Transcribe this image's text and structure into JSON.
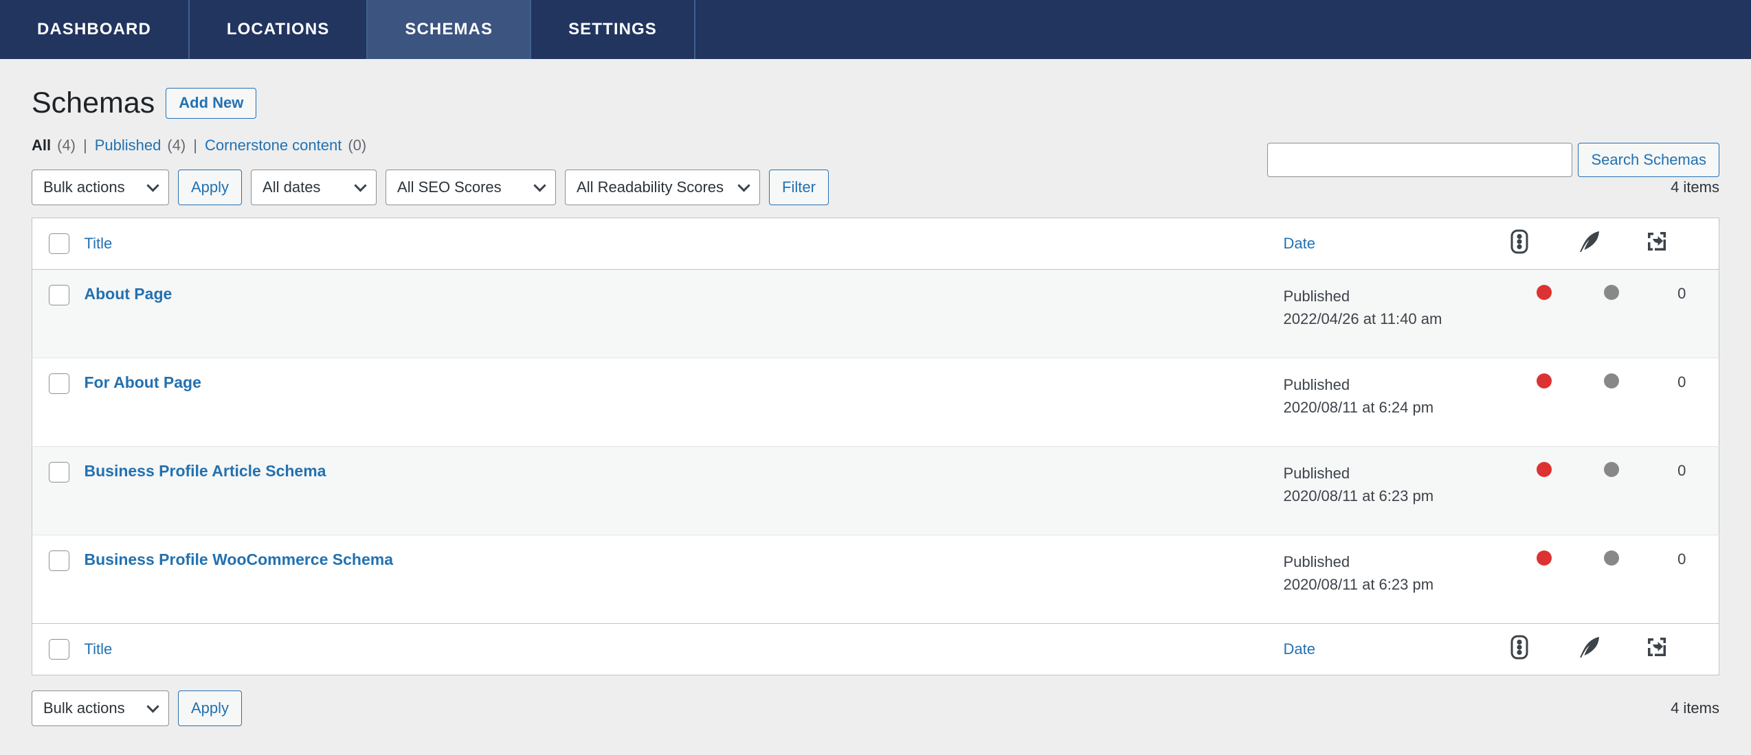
{
  "nav": {
    "tabs": [
      {
        "label": "DASHBOARD",
        "active": false
      },
      {
        "label": "LOCATIONS",
        "active": false
      },
      {
        "label": "SCHEMAS",
        "active": true
      },
      {
        "label": "SETTINGS",
        "active": false
      }
    ]
  },
  "header": {
    "title": "Schemas",
    "add_new_label": "Add New"
  },
  "status_links": {
    "all_label": "All",
    "all_count": "(4)",
    "published_label": "Published",
    "published_count": "(4)",
    "cornerstone_label": "Cornerstone content",
    "cornerstone_count": "(0)",
    "separator": "|"
  },
  "search": {
    "value": "",
    "placeholder": "",
    "button_label": "Search Schemas"
  },
  "toolbar_top": {
    "bulk_actions": "Bulk actions",
    "apply_label": "Apply",
    "all_dates": "All dates",
    "all_seo_scores": "All SEO Scores",
    "all_readability_scores": "All Readability Scores",
    "filter_label": "Filter",
    "items_count": "4 items"
  },
  "toolbar_bottom": {
    "bulk_actions": "Bulk actions",
    "apply_label": "Apply",
    "items_count": "4 items"
  },
  "table": {
    "columns": {
      "title": "Title",
      "date": "Date",
      "seo_icon": "traffic-light-icon",
      "readability_icon": "feather-icon",
      "links_icon": "incoming-links-icon"
    },
    "rows": [
      {
        "title": "About Page",
        "status": "Published",
        "datetime": "2022/04/26 at 11:40 am",
        "seo_color": "#dc3232",
        "readability_color": "#888888",
        "links": "0"
      },
      {
        "title": "For About Page",
        "status": "Published",
        "datetime": "2020/08/11 at 6:24 pm",
        "seo_color": "#dc3232",
        "readability_color": "#888888",
        "links": "0"
      },
      {
        "title": "Business Profile Article Schema",
        "status": "Published",
        "datetime": "2020/08/11 at 6:23 pm",
        "seo_color": "#dc3232",
        "readability_color": "#888888",
        "links": "0"
      },
      {
        "title": "Business Profile WooCommerce Schema",
        "status": "Published",
        "datetime": "2020/08/11 at 6:23 pm",
        "seo_color": "#dc3232",
        "readability_color": "#888888",
        "links": "0"
      }
    ]
  },
  "colors": {
    "nav_bg": "#22355f",
    "nav_active": "#3c5480",
    "link": "#2271b1",
    "page_bg": "#eeeeee",
    "bad_score": "#dc3232",
    "na_score": "#888888"
  }
}
